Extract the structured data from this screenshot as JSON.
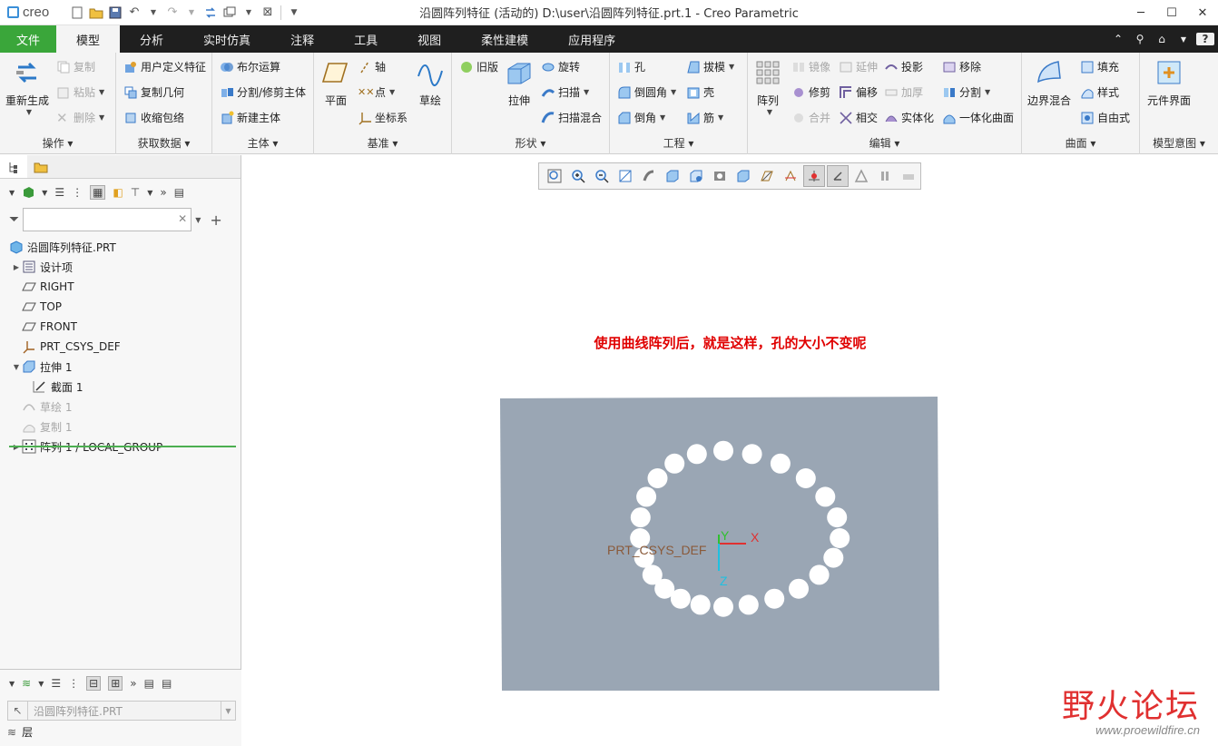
{
  "app": {
    "logo": "creo",
    "window_title": "沿圆阵列特征 (活动的) D:\\user\\沿圆阵列特征.prt.1 - Creo Parametric",
    "window_controls": [
      "minimize-icon",
      "maximize-icon",
      "close-icon"
    ]
  },
  "tabs": [
    {
      "label": "文件"
    },
    {
      "label": "模型"
    },
    {
      "label": "分析"
    },
    {
      "label": "实时仿真"
    },
    {
      "label": "注释"
    },
    {
      "label": "工具"
    },
    {
      "label": "视图"
    },
    {
      "label": "柔性建模"
    },
    {
      "label": "应用程序"
    }
  ],
  "ribbon": {
    "operations": {
      "label": "操作",
      "regenerate": "重新生成",
      "copy": "复制",
      "paste": "粘贴",
      "delete": "删除"
    },
    "get_data": {
      "label": "获取数据",
      "udf": "用户定义特征",
      "copy_geom": "复制几何",
      "shrinkwrap": "收缩包络"
    },
    "body": {
      "label": "主体",
      "boolean": "布尔运算",
      "split_trim": "分割/修剪主体",
      "new_body": "新建主体"
    },
    "datum": {
      "label": "基准",
      "plane": "平面",
      "axis": "轴",
      "point": "点",
      "csys": "坐标系",
      "sketch": "草绘"
    },
    "shapes": {
      "label": "形状",
      "legacy": "旧版",
      "extrude": "拉伸",
      "revolve": "旋转",
      "sweep": "扫描",
      "swept_blend": "扫描混合"
    },
    "engineering": {
      "label": "工程",
      "hole": "孔",
      "round": "倒圆角",
      "chamfer": "倒角",
      "draft": "拔模",
      "shell": "壳",
      "rib": "筋"
    },
    "editing": {
      "label": "编辑",
      "pattern": "阵列",
      "mirror": "镜像",
      "trim": "修剪",
      "merge": "合并",
      "extend": "延伸",
      "offset": "偏移",
      "intersect": "相交",
      "project": "投影",
      "thicken": "加厚",
      "solidify": "实体化",
      "remove": "移除",
      "split": "分割",
      "unify_surface": "一体化曲面"
    },
    "surfaces": {
      "label": "曲面",
      "boundary_blend": "边界混合",
      "fill": "填充",
      "style": "样式",
      "freestyle": "自由式"
    },
    "model_intent": {
      "label": "模型意图",
      "component_interface": "元件界面"
    }
  },
  "model_tree": {
    "filter_placeholder": "",
    "root": "沿圆阵列特征.PRT",
    "items": [
      {
        "label": "设计项",
        "icon": "design-items-icon",
        "state": "normal"
      },
      {
        "label": "RIGHT",
        "icon": "datum-plane-icon",
        "state": "normal"
      },
      {
        "label": "TOP",
        "icon": "datum-plane-icon",
        "state": "normal"
      },
      {
        "label": "FRONT",
        "icon": "datum-plane-icon",
        "state": "normal"
      },
      {
        "label": "PRT_CSYS_DEF",
        "icon": "csys-icon",
        "state": "normal"
      },
      {
        "label": "拉伸 1",
        "icon": "extrude-icon",
        "state": "normal"
      },
      {
        "label": "截面 1",
        "icon": "sketch-section-icon",
        "state": "normal"
      },
      {
        "label": "草绘 1",
        "icon": "sketch-icon",
        "state": "dim"
      },
      {
        "label": "复制 1",
        "icon": "copy-icon",
        "state": "dim"
      },
      {
        "label": "阵列 1 / LOCAL_GROUP",
        "icon": "pattern-icon",
        "state": "normal"
      }
    ]
  },
  "layer_panel": {
    "selected_model": "沿圆阵列特征.PRT",
    "layer_label": "层"
  },
  "graphics": {
    "annotation": "使用曲线阵列后，就是这样，孔的大小不变呢",
    "csys_label": "PRT_CSYS_DEF",
    "axis_x": "X",
    "axis_y": "Y",
    "axis_z": "Z",
    "plate_color": "#9aa6b4",
    "hole_count": 24
  },
  "watermark": {
    "main": "野火论坛",
    "sub": "www.proewildfire.cn"
  },
  "colors": {
    "file_tab": "#3aa63a",
    "tab_bar": "#1f1f1f",
    "annotation": "#e00000",
    "csys_x": "#e03030",
    "csys_y": "#30c030",
    "csys_z": "#20c0e0"
  }
}
